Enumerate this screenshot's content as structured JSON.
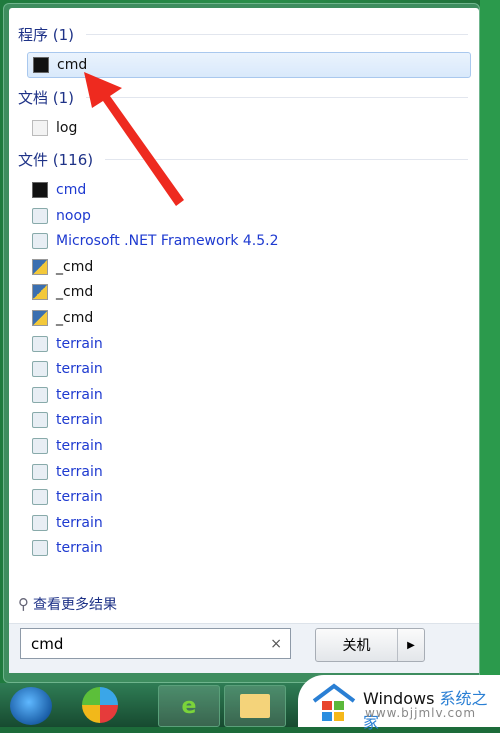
{
  "sections": [
    {
      "title": "程序 (1)",
      "items": [
        {
          "label": "cmd",
          "icon": "cmd-icon",
          "selected": true
        }
      ]
    },
    {
      "title": "文档 (1)",
      "items": [
        {
          "label": "log",
          "icon": "document-icon"
        }
      ]
    },
    {
      "title": "文件 (116)",
      "items": [
        {
          "label": "cmd",
          "icon": "cmd-file-icon"
        },
        {
          "label": "noop",
          "icon": "search-file-icon"
        },
        {
          "label": "Microsoft .NET Framework 4.5.2",
          "icon": "search-file-icon"
        },
        {
          "label": "_cmd",
          "icon": "python-file-icon"
        },
        {
          "label": "_cmd",
          "icon": "python-file-icon"
        },
        {
          "label": "_cmd",
          "icon": "python-file-icon"
        },
        {
          "label": "terrain",
          "icon": "search-file-icon"
        },
        {
          "label": "terrain",
          "icon": "search-file-icon"
        },
        {
          "label": "terrain",
          "icon": "search-file-icon"
        },
        {
          "label": "terrain",
          "icon": "search-file-icon"
        },
        {
          "label": "terrain",
          "icon": "search-file-icon"
        },
        {
          "label": "terrain",
          "icon": "search-file-icon"
        },
        {
          "label": "terrain",
          "icon": "search-file-icon"
        },
        {
          "label": "terrain",
          "icon": "search-file-icon"
        },
        {
          "label": "terrain",
          "icon": "search-file-icon"
        }
      ]
    }
  ],
  "more_results": "查看更多结果",
  "search": {
    "value": "cmd",
    "clear": "×"
  },
  "shutdown": {
    "label": "关机",
    "arrow": "▶"
  },
  "watermark": {
    "brand": "Windows",
    "brand_cn": "系统之家",
    "url": "www.bjjmlv.com"
  },
  "colors": {
    "link": "#1e3ad0",
    "header": "#1e3287",
    "arrow": "#ee2a1f"
  }
}
